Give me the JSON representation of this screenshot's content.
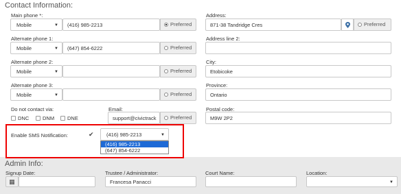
{
  "contact": {
    "title": "Contact Information:",
    "main_phone": {
      "label": "Main phone *:",
      "type": "Mobile",
      "number": "(416) 985-2213",
      "preferred": "Preferred"
    },
    "alt_phone_1": {
      "label": "Alternate phone 1:",
      "type": "Mobile",
      "number": "(647) 854-6222",
      "preferred": "Preferred"
    },
    "alt_phone_2": {
      "label": "Alternate phone 2:",
      "type": "Mobile",
      "number": "",
      "preferred": "Preferred"
    },
    "alt_phone_3": {
      "label": "Alternate phone 3:",
      "type": "Mobile",
      "number": "",
      "preferred": "Preferred"
    },
    "do_not_contact": {
      "label": "Do not contact via:",
      "options": [
        "DNC",
        "DNM",
        "DNE"
      ]
    },
    "email": {
      "label": "Email:",
      "value": "support@civictrack",
      "preferred": "Preferred"
    },
    "address": {
      "label": "Address:",
      "value": "871-38 Tandridge Cres",
      "preferred": "Preferred"
    },
    "address2": {
      "label": "Address line 2:",
      "value": ""
    },
    "city": {
      "label": "City:",
      "value": "Etobicoke"
    },
    "province": {
      "label": "Province:",
      "value": "Ontario"
    },
    "postal": {
      "label": "Postal code:",
      "value": "M9W 2P2"
    },
    "sms": {
      "label": "Enable SMS Notification:",
      "checked": true,
      "selected": "(416) 985-2213",
      "options": [
        "(416) 985-2213",
        "(647) 854-6222"
      ]
    }
  },
  "admin": {
    "title": "Admin Info:",
    "signup_label": "Signup Date:",
    "signup_value": "",
    "trustee_label": "Trustee / Administrator:",
    "trustee_value": "Francesa Panacci",
    "court_label": "Court Name:",
    "court_value": "",
    "location_label": "Location:",
    "location_value": ""
  },
  "icons": {
    "map_pin": "map-marker-icon",
    "calendar": "calendar-icon",
    "caret": "caret-down-icon",
    "check": "checkmark-icon"
  },
  "colors": {
    "highlight": "#1e6ad6",
    "annotation": "#e00000",
    "admin_bg": "#e9e9e9"
  }
}
